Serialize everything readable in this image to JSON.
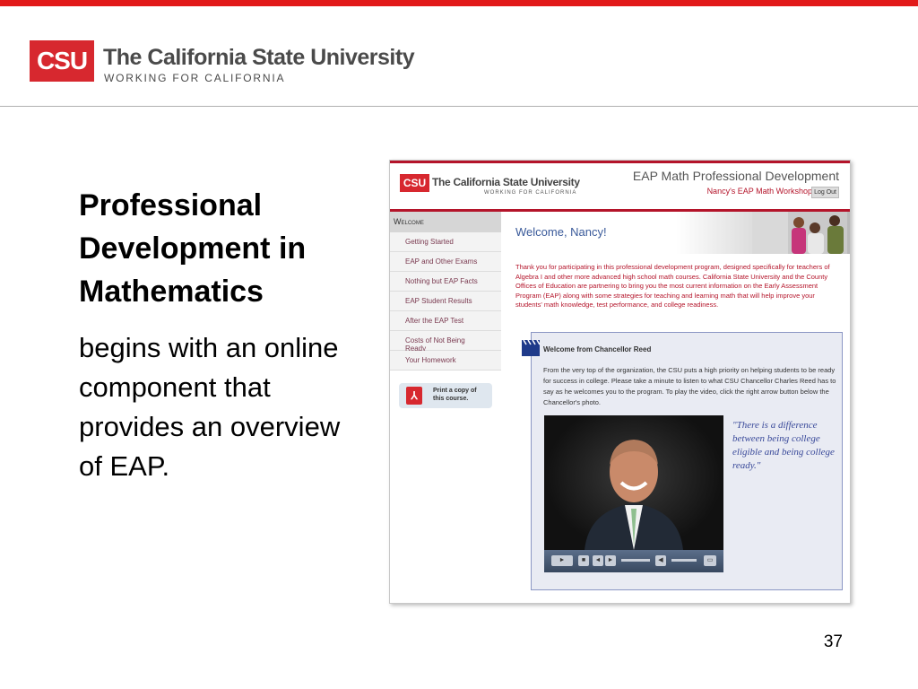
{
  "header": {
    "logo_abbr": "CSU",
    "university_name": "The California State University",
    "tagline": "WORKING FOR CALIFORNIA"
  },
  "slide": {
    "title": "Professional Development in Mathematics",
    "body": "begins with an online component that provides an overview of EAP.",
    "page_number": "37"
  },
  "screenshot": {
    "logo_abbr": "CSU",
    "university_name": "The California State University",
    "tagline": "WORKING FOR CALIFORNIA",
    "app_title": "EAP Math Professional Development",
    "workshop_label": "Nancy's EAP Math Workshop",
    "logout_label": "Log Out",
    "nav": {
      "heading": "Welcome",
      "items": [
        "Getting Started",
        "EAP and Other Exams",
        "Nothing but EAP Facts",
        "EAP Student Results",
        "After the EAP Test",
        "Costs of Not Being Ready",
        "Your Homework"
      ],
      "print_label": "Print a copy of this course."
    },
    "welcome_title": "Welcome, Nancy!",
    "intro": "Thank you for participating in this professional development program, designed specifically for teachers of Algebra I and other more advanced high school math courses. California State University and the County Offices of Education are partnering to bring you the most current information on the Early Assessment Program (EAP) along with some strategies for teaching and learning math that will help improve your students' math knowledge, test performance, and college readiness.",
    "chancellor": {
      "title": "Welcome from Chancellor Reed",
      "text": "From the very top of the organization, the CSU puts a high priority on helping students to be ready for success in college. Please take a minute to listen to what CSU Chancellor Charles Reed has to say as he welcomes you to the program. To play the video, click the right arrow button below the Chancellor's photo.",
      "quote": "\"There is a difference between being college eligible and being college ready.\""
    },
    "video": {
      "play_icon": "play-icon",
      "stop_icon": "stop-icon",
      "volume_icon": "volume-icon"
    }
  },
  "colors": {
    "accent_red": "#d7282f",
    "top_bar": "#e21a1a",
    "link_blue": "#3a5a9a"
  }
}
